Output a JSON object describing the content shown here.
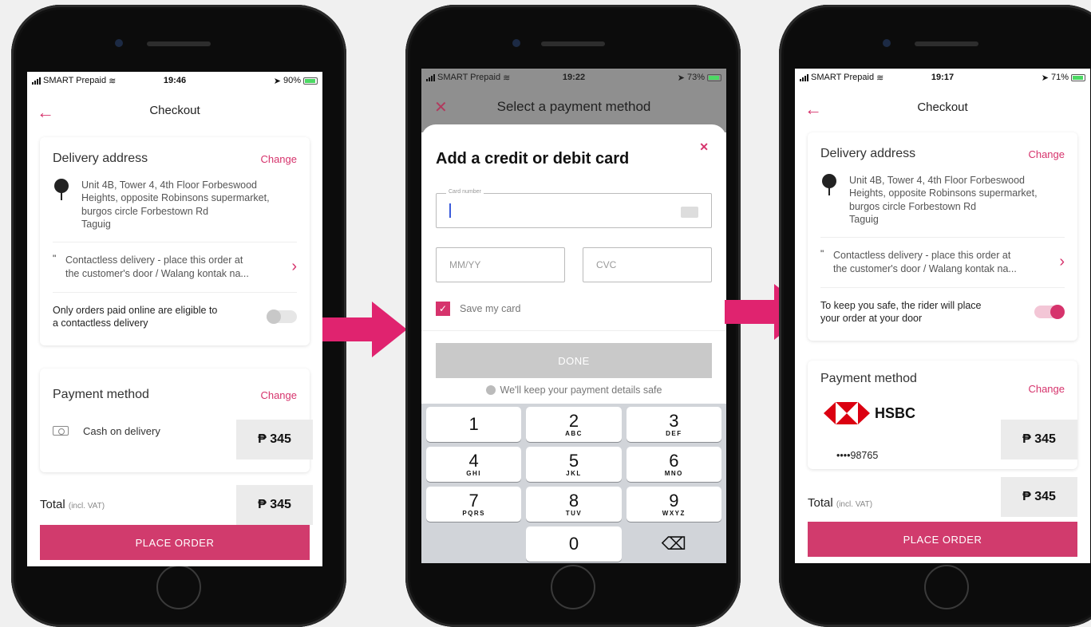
{
  "colors": {
    "accent": "#d13b6d",
    "arrow": "#e0236f"
  },
  "phone1": {
    "status": {
      "carrier": "SMART Prepaid",
      "time": "19:46",
      "battery": "90%"
    },
    "nav_title": "Checkout",
    "delivery": {
      "title": "Delivery address",
      "change": "Change",
      "address": [
        "Unit 4B, Tower 4, 4th Floor Forbeswood",
        "Heights, opposite Robinsons supermarket,",
        "burgos circle Forbestown Rd",
        "Taguig"
      ],
      "note": [
        "Contactless delivery - place this order at",
        "the customer's door / Walang kontak na..."
      ],
      "toggle_text": [
        "Only orders paid online are eligible to",
        "a contactless delivery"
      ]
    },
    "payment": {
      "title": "Payment method",
      "change": "Change",
      "method": "Cash on delivery",
      "price": "₱ 345"
    },
    "total": {
      "label": "Total",
      "sub": "(incl. VAT)",
      "price": "₱ 345"
    },
    "cta": "PLACE ORDER"
  },
  "phone2": {
    "status": {
      "carrier": "SMART Prepaid",
      "time": "19:22",
      "battery": "73%"
    },
    "bg_title": "Select a payment method",
    "sheet_title": "Add a credit or debit card",
    "card_number_legend": "Card number",
    "expiry_placeholder": "MM/YY",
    "cvc_placeholder": "CVC",
    "save_card": "Save my card",
    "done": "DONE",
    "safe_text": "We'll keep your payment details safe",
    "keys": [
      {
        "d": "1",
        "l": ""
      },
      {
        "d": "2",
        "l": "ABC"
      },
      {
        "d": "3",
        "l": "DEF"
      },
      {
        "d": "4",
        "l": "GHI"
      },
      {
        "d": "5",
        "l": "JKL"
      },
      {
        "d": "6",
        "l": "MNO"
      },
      {
        "d": "7",
        "l": "PQRS"
      },
      {
        "d": "8",
        "l": "TUV"
      },
      {
        "d": "9",
        "l": "WXYZ"
      },
      {
        "d": "",
        "l": ""
      },
      {
        "d": "0",
        "l": ""
      },
      {
        "d": "⌫",
        "l": ""
      }
    ]
  },
  "phone3": {
    "status": {
      "carrier": "SMART Prepaid",
      "time": "19:17",
      "battery": "71%"
    },
    "nav_title": "Checkout",
    "delivery": {
      "title": "Delivery address",
      "change": "Change",
      "address": [
        "Unit 4B, Tower 4, 4th Floor Forbeswood",
        "Heights, opposite Robinsons supermarket,",
        "burgos circle Forbestown Rd",
        "Taguig"
      ],
      "note": [
        "Contactless delivery - place this order at",
        "the customer's door / Walang kontak na..."
      ],
      "toggle_text": [
        "To keep you safe, the rider will place",
        "your order at your door"
      ]
    },
    "payment": {
      "title": "Payment method",
      "change": "Change",
      "bank": "HSBC",
      "card_mask": "••••98765",
      "price": "₱ 345"
    },
    "total": {
      "label": "Total",
      "sub": "(incl. VAT)",
      "price": "₱ 345"
    },
    "cta": "PLACE ORDER"
  }
}
